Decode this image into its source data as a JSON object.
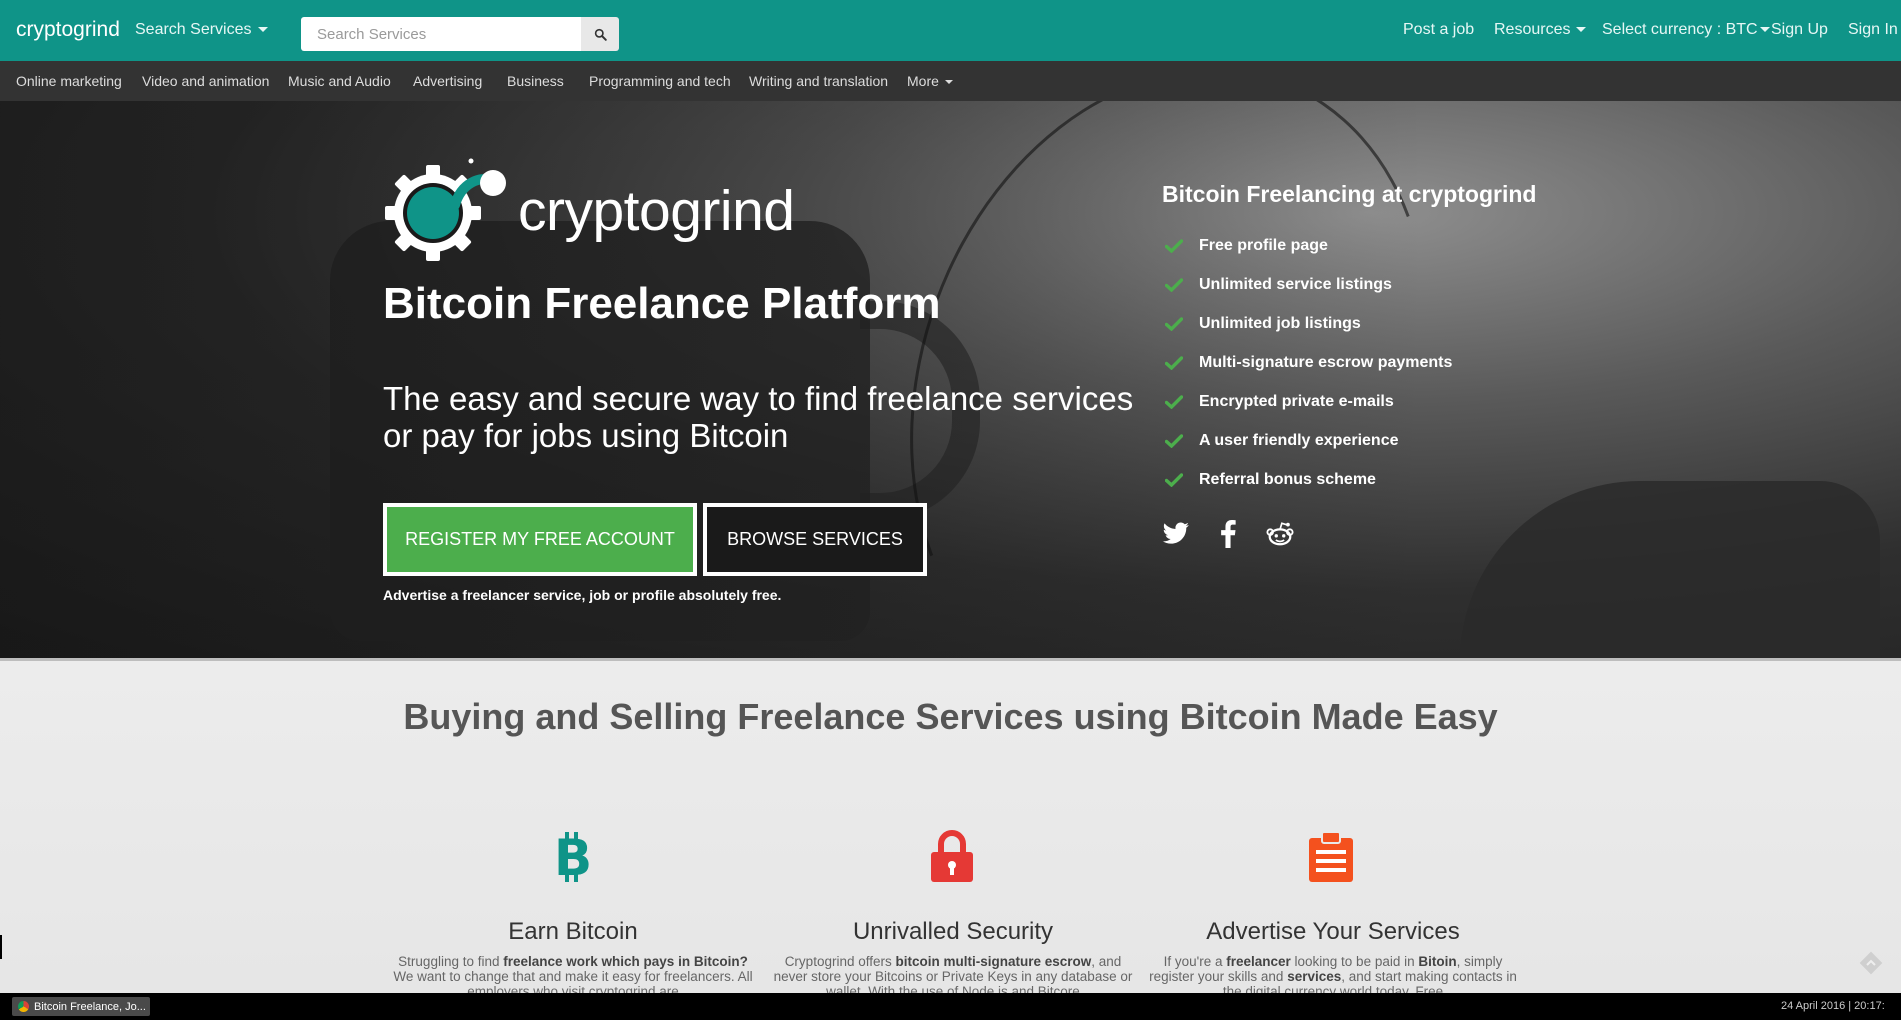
{
  "topbar": {
    "brand": "cryptogrind",
    "search_services_label": "Search Services",
    "search_placeholder": "Search Services",
    "post_job": "Post a job",
    "resources": "Resources",
    "currency": "Select currency : BTC",
    "sign_up": "Sign Up",
    "sign_in": "Sign In",
    "accent_color": "#0f9488"
  },
  "categories": [
    "Online marketing",
    "Video and animation",
    "Music and Audio",
    "Advertising",
    "Business",
    "Programming and tech",
    "Writing and translation",
    "More"
  ],
  "hero": {
    "logo_text": "cryptogrind",
    "title": "Bitcoin Freelance Platform",
    "subtitle": "The easy and secure way to find freelance services or pay for jobs using Bitcoin",
    "register_button": "REGISTER MY FREE ACCOUNT",
    "browse_button": "BROWSE SERVICES",
    "note": "Advertise a freelancer service, job or profile absolutely free.",
    "features_heading": "Bitcoin Freelancing at cryptogrind",
    "features": [
      "Free profile page",
      "Unlimited service listings",
      "Unlimited job listings",
      "Multi-signature escrow payments",
      "Encrypted private e-mails",
      "A user friendly experience",
      "Referral bonus scheme"
    ],
    "socials": [
      "twitter-icon",
      "facebook-icon",
      "reddit-icon"
    ],
    "register_color": "#4cae4c"
  },
  "lower": {
    "title": "Buying and Selling Freelance Services using Bitcoin Made Easy",
    "cards": [
      {
        "icon": "bitcoin-icon",
        "icon_color": "#0f9488",
        "title": "Earn Bitcoin",
        "p1": "Struggling to find ",
        "b1": "freelance work which pays in Bitcoin?",
        "p2": " We want to change that and make it easy for freelancers. All employers who visit cryptogrind are"
      },
      {
        "icon": "lock-icon",
        "icon_color": "#e53935",
        "title": "Unrivalled Security",
        "p1": "Cryptogrind offers ",
        "b1": "bitcoin multi-signature escrow",
        "p2": ", and never store your Bitcoins or Private Keys in any database or wallet. With the use of Node.js and Bitcore"
      },
      {
        "icon": "clipboard-icon",
        "icon_color": "#f4511e",
        "title": "Advertise Your Services",
        "p1": "If you're a ",
        "b1": "freelancer",
        "p2": " looking to be paid in ",
        "b2": "Bitoin",
        "p3": ", simply register your skills and ",
        "b3": "services",
        "p4": ", and start making contacts in the digital currency world today. Free"
      }
    ]
  },
  "taskbar": {
    "window_title": "Bitcoin Freelance, Jo...",
    "clock": "24 April 2016 | 20:17:"
  }
}
